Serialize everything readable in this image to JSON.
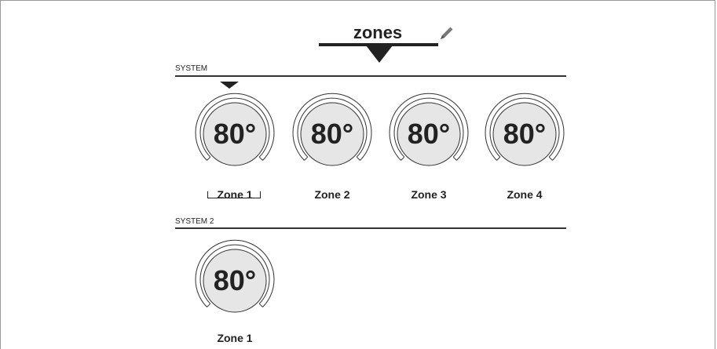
{
  "header": {
    "title": "zones"
  },
  "sections": [
    {
      "label": "SYSTEM",
      "zones": [
        {
          "temperature": "80°",
          "name": "Zone 1",
          "selected": true
        },
        {
          "temperature": "80°",
          "name": "Zone 2",
          "selected": false
        },
        {
          "temperature": "80°",
          "name": "Zone 3",
          "selected": false
        },
        {
          "temperature": "80°",
          "name": "Zone 4",
          "selected": false
        }
      ]
    },
    {
      "label": "SYSTEM 2",
      "zones": [
        {
          "temperature": "80°",
          "name": "Zone 1",
          "selected": false
        }
      ]
    }
  ],
  "icons": {
    "edit": "pencil-icon",
    "header_pointer": "triangle-down-icon",
    "active_indicator": "triangle-down-icon"
  },
  "colors": {
    "dial_fill": "#e6e6e6",
    "text": "#222222",
    "edit_icon": "#777777"
  }
}
